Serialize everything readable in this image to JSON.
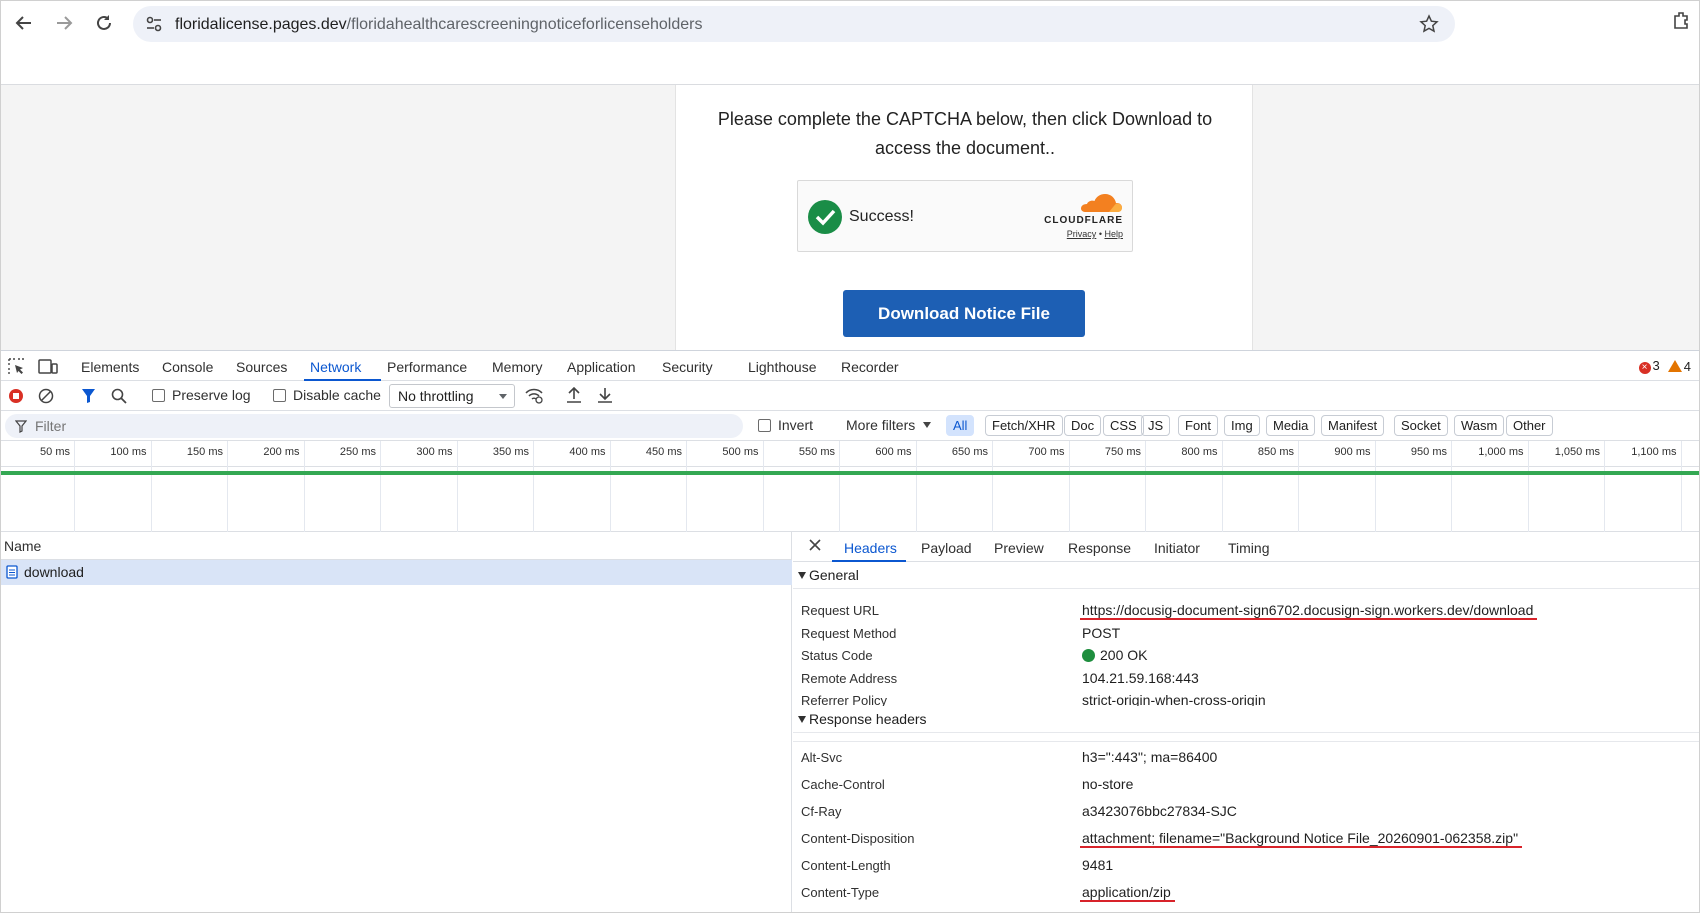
{
  "browser": {
    "url_host": "floridalicense.pages.dev",
    "url_path": "/floridahealthcarescreeningnoticeforlicenseholders"
  },
  "page": {
    "instruction": "Please complete the CAPTCHA below, then click Download to access the document..",
    "captcha": {
      "status": "Success!",
      "brand": "CLOUDFLARE",
      "privacy": "Privacy",
      "separator": "•",
      "help": "Help"
    },
    "download_button": "Download Notice File"
  },
  "devtools": {
    "tabs": [
      "Elements",
      "Console",
      "Sources",
      "Network",
      "Performance",
      "Memory",
      "Application",
      "Security",
      "Lighthouse",
      "Recorder"
    ],
    "active_tab": "Network",
    "error_count": "3",
    "warning_count": "4",
    "toolbar": {
      "preserve_log": "Preserve log",
      "disable_cache": "Disable cache",
      "throttling": "No throttling"
    },
    "filter": {
      "placeholder": "Filter",
      "invert": "Invert",
      "more_filters": "More filters",
      "types": [
        "All",
        "Fetch/XHR",
        "Doc",
        "CSS",
        "JS",
        "Font",
        "Img",
        "Media",
        "Manifest",
        "Socket",
        "Wasm",
        "Other"
      ],
      "active_type": "All"
    },
    "timeline_ticks": [
      "50 ms",
      "100 ms",
      "150 ms",
      "200 ms",
      "250 ms",
      "300 ms",
      "350 ms",
      "400 ms",
      "450 ms",
      "500 ms",
      "550 ms",
      "600 ms",
      "650 ms",
      "700 ms",
      "750 ms",
      "800 ms",
      "850 ms",
      "900 ms",
      "950 ms",
      "1,000 ms",
      "1,050 ms",
      "1,100 ms"
    ],
    "requests": {
      "column": "Name",
      "rows": [
        {
          "name": "download"
        }
      ]
    },
    "detail": {
      "tabs": [
        "Headers",
        "Payload",
        "Preview",
        "Response",
        "Initiator",
        "Timing"
      ],
      "active_tab": "Headers",
      "general": {
        "title": "General",
        "rows": [
          {
            "key": "Request URL",
            "value": "https://docusig-document-sign6702.docusign-sign.workers.dev/download",
            "underlined": true
          },
          {
            "key": "Request Method",
            "value": "POST"
          },
          {
            "key": "Status Code",
            "value": "200 OK",
            "status_color": "#1e8e3e"
          },
          {
            "key": "Remote Address",
            "value": "104.21.59.168:443"
          },
          {
            "key": "Referrer Policy",
            "value": "strict-origin-when-cross-origin"
          }
        ]
      },
      "response_headers": {
        "title": "Response headers",
        "rows": [
          {
            "key": "Alt-Svc",
            "value": "h3=\":443\"; ma=86400"
          },
          {
            "key": "Cache-Control",
            "value": "no-store"
          },
          {
            "key": "Cf-Ray",
            "value": "a3423076bbc27834-SJC"
          },
          {
            "key": "Content-Disposition",
            "value": "attachment; filename=\"Background Notice File_20260901-062358.zip\"",
            "underlined": true
          },
          {
            "key": "Content-Length",
            "value": "9481"
          },
          {
            "key": "Content-Type",
            "value": "application/zip",
            "underlined": true
          }
        ]
      }
    }
  },
  "colors": {
    "accent_blue": "#0b57d0",
    "download_button": "#1d5fb4",
    "annotation_red": "#d8232a",
    "cloudflare_orange": "#f38020"
  }
}
